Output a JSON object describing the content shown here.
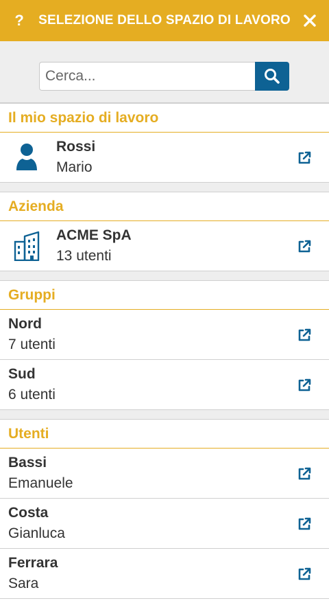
{
  "header": {
    "help_label": "?",
    "title": "SELEZIONE DELLO SPAZIO DI LAVORO",
    "close_label": "close"
  },
  "search": {
    "placeholder": "Cerca...",
    "value": ""
  },
  "colors": {
    "accent": "#e5ad22",
    "primary": "#0e6294",
    "background": "#eeeeee"
  },
  "my_workspace": {
    "title": "Il mio spazio di lavoro",
    "icon": "user-icon",
    "name": "Rossi",
    "sub": "Mario"
  },
  "company": {
    "title": "Azienda",
    "icon": "building-icon",
    "name": "ACME SpA",
    "sub": "13 utenti"
  },
  "groups": {
    "title": "Gruppi",
    "items": [
      {
        "name": "Nord",
        "sub": "7 utenti"
      },
      {
        "name": "Sud",
        "sub": "6 utenti"
      }
    ]
  },
  "users": {
    "title": "Utenti",
    "items": [
      {
        "name": "Bassi",
        "sub": "Emanuele"
      },
      {
        "name": "Costa",
        "sub": "Gianluca"
      },
      {
        "name": "Ferrara",
        "sub": "Sara"
      }
    ]
  }
}
